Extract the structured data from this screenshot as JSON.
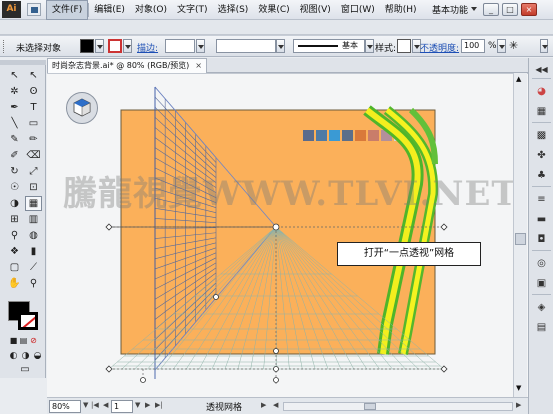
{
  "app": {
    "logo": "Ai",
    "workspace": "基本功能"
  },
  "menus": [
    "文件(F)",
    "编辑(E)",
    "对象(O)",
    "文字(T)",
    "选择(S)",
    "效果(C)",
    "视图(V)",
    "窗口(W)",
    "帮助(H)"
  ],
  "window_buttons": {
    "minimize": "_",
    "restore": "□",
    "close": "×"
  },
  "control_bar": {
    "selection": "未选择对象",
    "stroke_label": "描边:",
    "style_label": "样式:",
    "brush_name": "基本",
    "opacity_label": "不透明度:",
    "opacity_value": "100",
    "opacity_unit": "%"
  },
  "document": {
    "tab_title": "时尚杂志背景.ai* @ 80% (RGB/预览)",
    "tab_close": "×"
  },
  "canvas": {
    "watermark": "騰龍視覺WWW.TLVI.NET",
    "callout": "打开“一点透视”网格",
    "artboard_color": "#fbb05a",
    "swatches": [
      "#5a6b8c",
      "#4e7ba6",
      "#3a9ad4",
      "#5c6f8a",
      "#d9793a",
      "#c97d6a",
      "#b3909a",
      "#d9d9d9"
    ]
  },
  "status_bar": {
    "zoom": "80%",
    "page": "1",
    "status": "透视网格"
  },
  "tools": [
    {
      "name": "selection-tool",
      "glyph": "↖"
    },
    {
      "name": "direct-selection-tool",
      "glyph": "↖"
    },
    {
      "name": "magic-wand-tool",
      "glyph": "✲"
    },
    {
      "name": "lasso-tool",
      "glyph": "ʘ"
    },
    {
      "name": "pen-tool",
      "glyph": "✒"
    },
    {
      "name": "type-tool",
      "glyph": "T"
    },
    {
      "name": "line-tool",
      "glyph": "╲"
    },
    {
      "name": "rectangle-tool",
      "glyph": "▭"
    },
    {
      "name": "paintbrush-tool",
      "glyph": "✎"
    },
    {
      "name": "pencil-tool",
      "glyph": "✏"
    },
    {
      "name": "blob-brush-tool",
      "glyph": "✐"
    },
    {
      "name": "eraser-tool",
      "glyph": "⌫"
    },
    {
      "name": "rotate-tool",
      "glyph": "↻"
    },
    {
      "name": "scale-tool",
      "glyph": "⤢"
    },
    {
      "name": "warp-tool",
      "glyph": "☉"
    },
    {
      "name": "free-transform-tool",
      "glyph": "⊡"
    },
    {
      "name": "shape-builder-tool",
      "glyph": "◑"
    },
    {
      "name": "perspective-grid-tool",
      "glyph": "▦"
    },
    {
      "name": "mesh-tool",
      "glyph": "⊞"
    },
    {
      "name": "gradient-tool",
      "glyph": "▥"
    },
    {
      "name": "eyedropper-tool",
      "glyph": "⚲"
    },
    {
      "name": "blend-tool",
      "glyph": "◍"
    },
    {
      "name": "symbol-sprayer-tool",
      "glyph": "❖"
    },
    {
      "name": "column-graph-tool",
      "glyph": "▮"
    },
    {
      "name": "artboard-tool",
      "glyph": "▢"
    },
    {
      "name": "slice-tool",
      "glyph": "⟋"
    },
    {
      "name": "hand-tool",
      "glyph": "✋"
    },
    {
      "name": "zoom-tool",
      "glyph": "⚲"
    }
  ]
}
